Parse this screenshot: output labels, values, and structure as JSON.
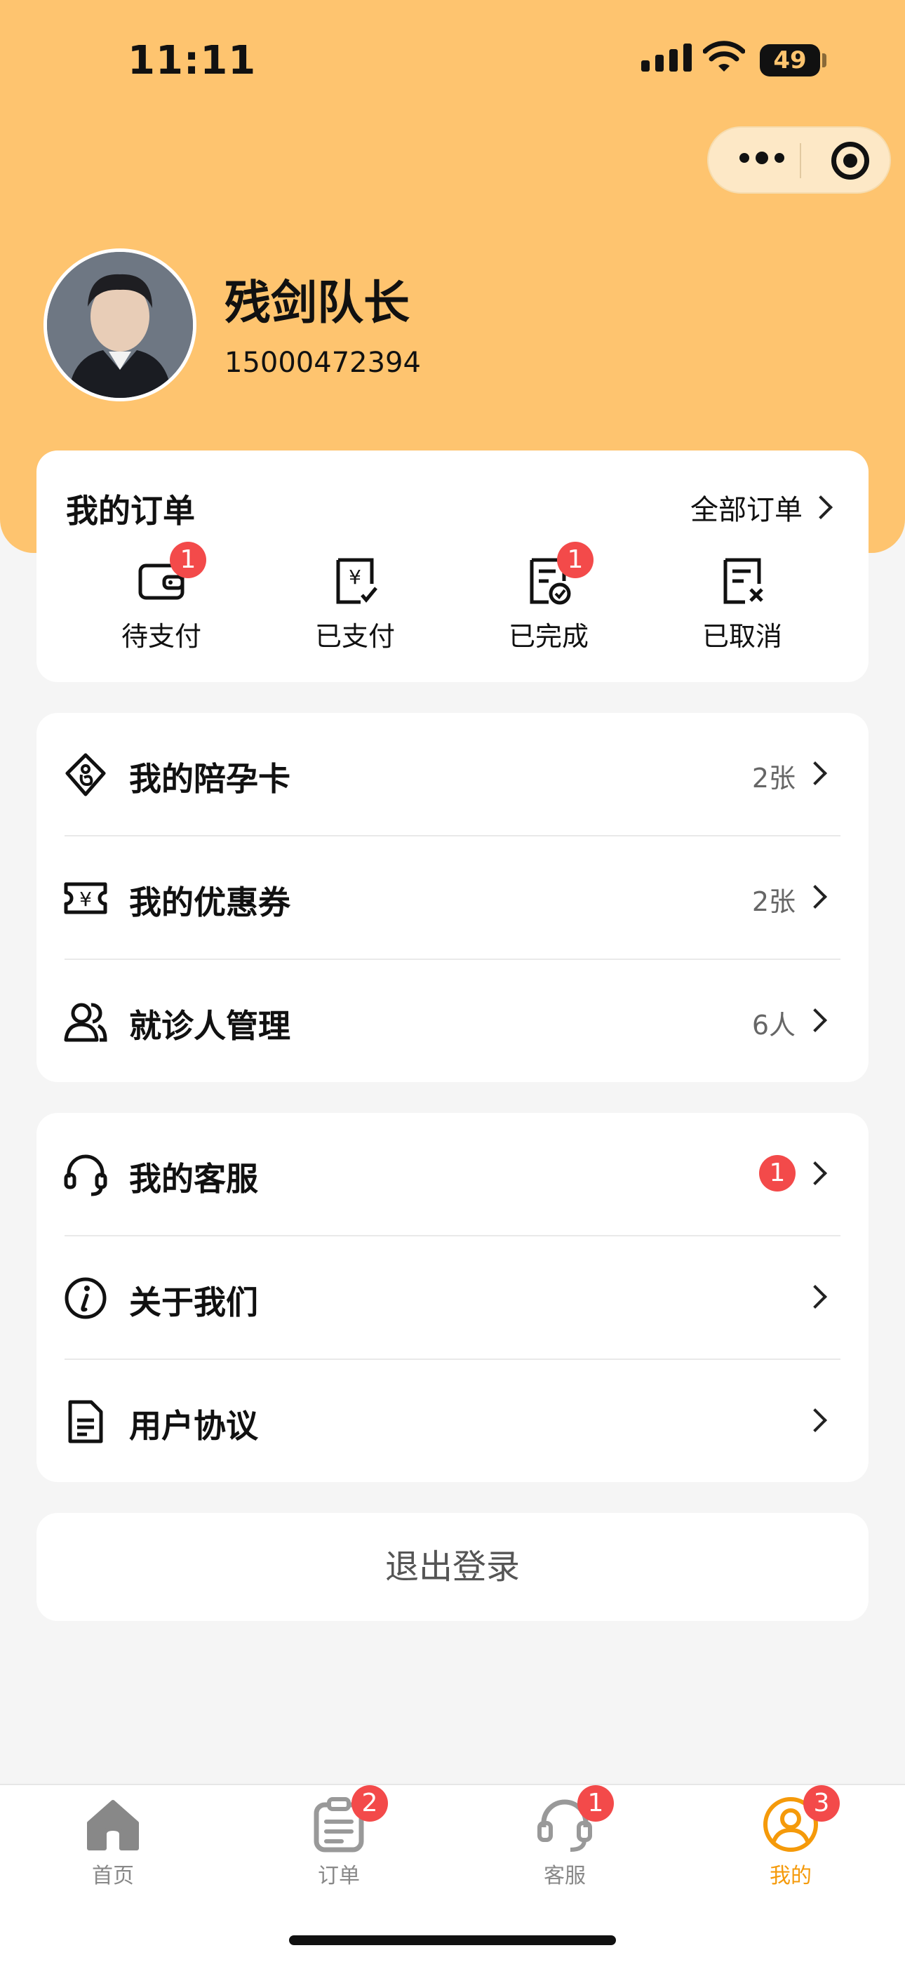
{
  "status_bar": {
    "time": "11:11",
    "battery": "49"
  },
  "profile": {
    "name": "残剑队长",
    "phone": "15000472394"
  },
  "orders": {
    "title": "我的订单",
    "all_label": "全部订单",
    "items": [
      {
        "label": "待支付",
        "badge": "1",
        "icon": "wallet-icon"
      },
      {
        "label": "已支付",
        "badge": "",
        "icon": "paid-receipt-icon"
      },
      {
        "label": "已完成",
        "badge": "1",
        "icon": "completed-receipt-icon"
      },
      {
        "label": "已取消",
        "badge": "",
        "icon": "cancelled-receipt-icon"
      }
    ]
  },
  "menu1": [
    {
      "label": "我的陪孕卡",
      "value": "2张",
      "icon": "pregnancy-card-icon"
    },
    {
      "label": "我的优惠券",
      "value": "2张",
      "icon": "coupon-icon"
    },
    {
      "label": "就诊人管理",
      "value": "6人",
      "icon": "users-icon"
    }
  ],
  "menu2": [
    {
      "label": "我的客服",
      "badge": "1",
      "icon": "headset-icon"
    },
    {
      "label": "关于我们",
      "icon": "info-icon"
    },
    {
      "label": "用户协议",
      "icon": "document-icon"
    }
  ],
  "logout_label": "退出登录",
  "tabbar": [
    {
      "label": "首页",
      "badge": "",
      "icon": "home-icon"
    },
    {
      "label": "订单",
      "badge": "2",
      "icon": "order-list-icon"
    },
    {
      "label": "客服",
      "badge": "1",
      "icon": "headset-icon"
    },
    {
      "label": "我的",
      "badge": "3",
      "icon": "user-icon",
      "active": true
    }
  ],
  "colors": {
    "header": "#fec46f",
    "badge": "#f34a4a",
    "accent": "#f59a0a"
  }
}
